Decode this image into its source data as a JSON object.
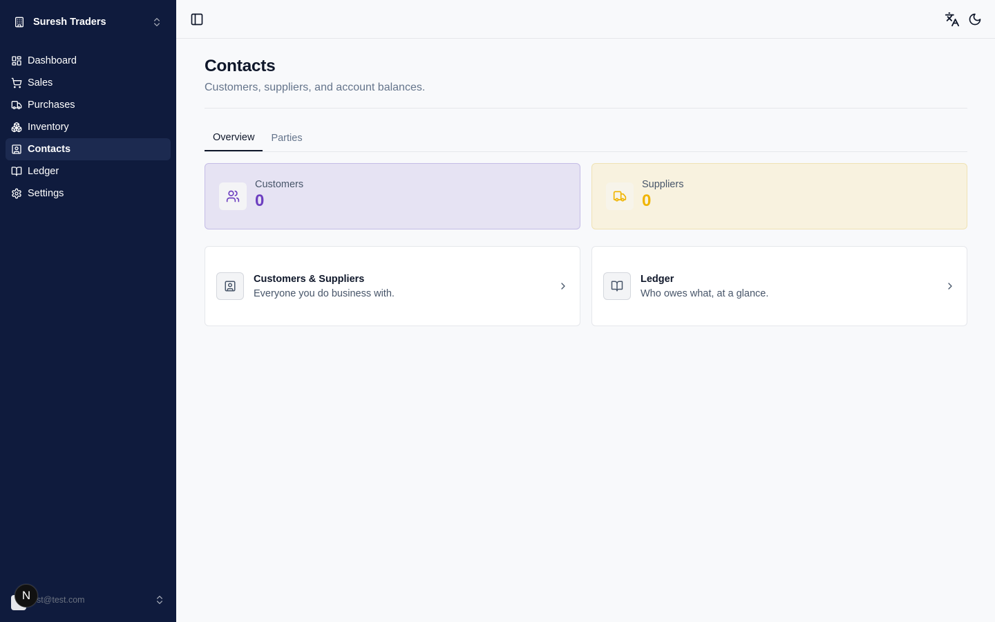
{
  "sidebar": {
    "org_name": "Suresh Traders",
    "items": [
      {
        "label": "Dashboard",
        "icon": "dashboard-icon"
      },
      {
        "label": "Sales",
        "icon": "cart-icon"
      },
      {
        "label": "Purchases",
        "icon": "truck-icon"
      },
      {
        "label": "Inventory",
        "icon": "boxes-icon"
      },
      {
        "label": "Contacts",
        "icon": "contact-icon",
        "active": true
      },
      {
        "label": "Ledger",
        "icon": "book-icon"
      },
      {
        "label": "Settings",
        "icon": "gear-icon"
      }
    ],
    "user_email": "est@test.com",
    "next_badge": "N"
  },
  "header": {
    "toggle_icon": "sidebar-toggle-icon",
    "translate_icon": "translate-icon",
    "theme_icon": "moon-icon"
  },
  "page": {
    "title": "Contacts",
    "subtitle": "Customers, suppliers, and account balances."
  },
  "tabs": [
    {
      "label": "Overview",
      "active": true
    },
    {
      "label": "Parties",
      "active": false
    }
  ],
  "stats": {
    "customers": {
      "label": "Customers",
      "value": "0",
      "color": "#6d3fc0"
    },
    "suppliers": {
      "label": "Suppliers",
      "value": "0",
      "color": "#f0b400"
    }
  },
  "links": {
    "customers_suppliers": {
      "title": "Customers & Suppliers",
      "description": "Everyone you do business with."
    },
    "ledger": {
      "title": "Ledger",
      "description": "Who owes what, at a glance."
    }
  }
}
